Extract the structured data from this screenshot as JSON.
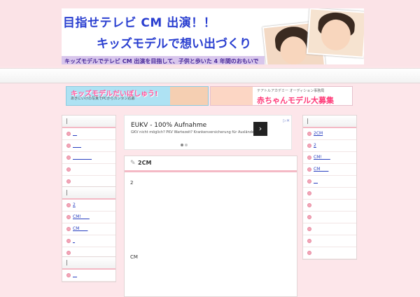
{
  "header": {
    "line1": "目指せテレビ CM 出演！！",
    "line2": "キッズモデルで想い出づくり",
    "line3": "キッズモデルでテレビ CM 出演を目指して、子供と歩いた 4 年間のおもいで"
  },
  "banner_ads": {
    "left": {
      "title": "キッズモデルだいぼしゅう!",
      "sub": "あきにいけの写真でPCからカンタン応募"
    },
    "right": {
      "title": "赤ちゃんモデル大募集",
      "sub": "テアトルアカデミー オーディション事務局"
    }
  },
  "ad": {
    "headline": "EUKV - 100% Aufnahme",
    "subline": "GKV nicht möglich? PKV Wartezeit? Krankenversicherung für Ausländer",
    "cta_icon": "chevron-right-icon",
    "adchoices": "▷✕"
  },
  "post": {
    "title": "2CM",
    "line1": "2",
    "line2": "CM"
  },
  "left_sidebar": [
    {
      "items": [
        "__",
        "____",
        "_________",
        "",
        ""
      ]
    },
    {
      "items": [
        "2",
        "CM!____",
        "CM____",
        "_",
        ""
      ]
    },
    {
      "items": [
        "__"
      ]
    }
  ],
  "right_sidebar": {
    "items": [
      "2CM",
      "2",
      "CM!____",
      "CM____",
      "__",
      "",
      "",
      "",
      "",
      "",
      ""
    ]
  },
  "colors": {
    "accent": "#f4b9c5",
    "link": "#2a40c0",
    "page_bg": "#fde6ea"
  }
}
